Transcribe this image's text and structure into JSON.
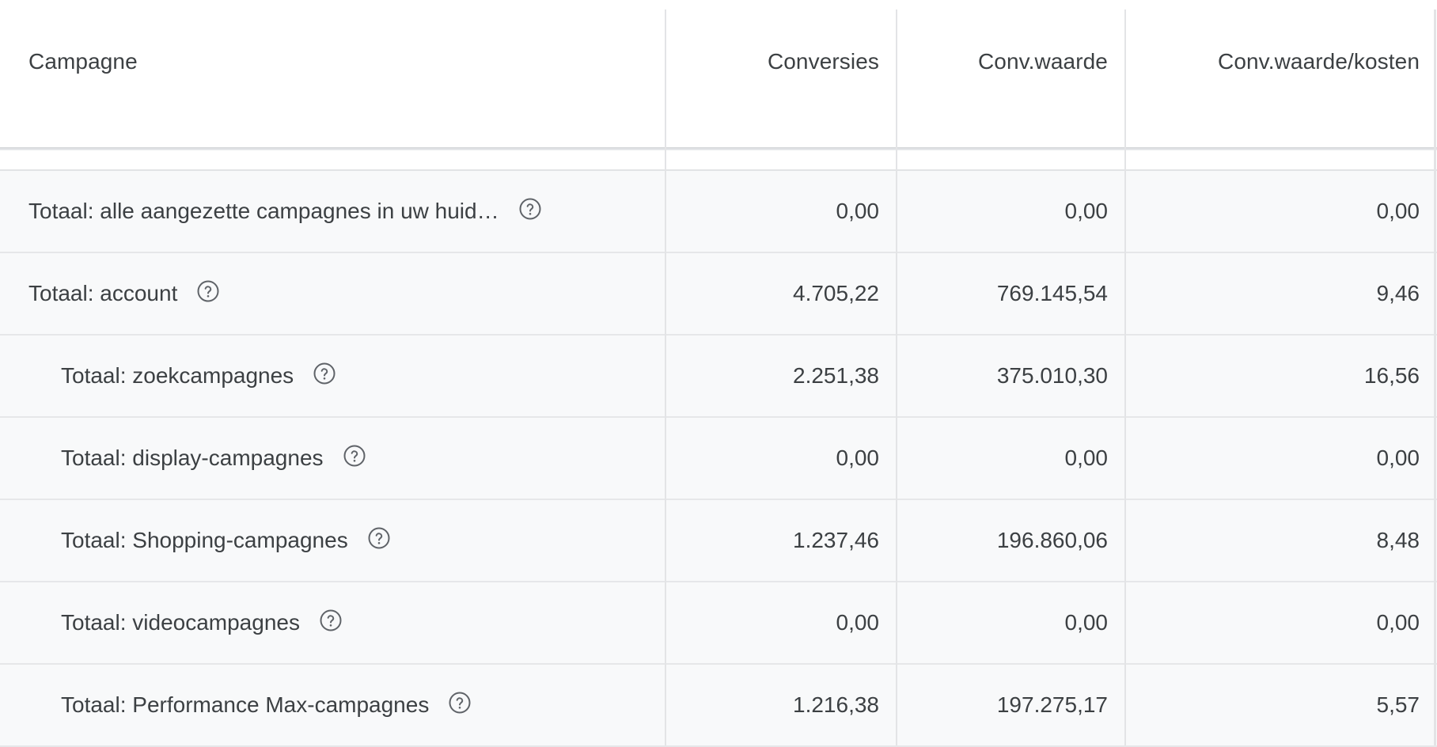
{
  "columns": {
    "campaign": "Campagne",
    "conversions": "Conversies",
    "conv_value": "Conv.waarde",
    "conv_value_cost": "Conv.waarde/kosten"
  },
  "rows": [
    {
      "label": "Totaal: alle aangezette campagnes in uw huid…",
      "conversions": "0,00",
      "conv_value": "0,00",
      "conv_value_cost": "0,00",
      "indent": false
    },
    {
      "label": "Totaal: account",
      "conversions": "4.705,22",
      "conv_value": "769.145,54",
      "conv_value_cost": "9,46",
      "indent": false
    },
    {
      "label": "Totaal: zoekcampagnes",
      "conversions": "2.251,38",
      "conv_value": "375.010,30",
      "conv_value_cost": "16,56",
      "indent": true
    },
    {
      "label": "Totaal: display-campagnes",
      "conversions": "0,00",
      "conv_value": "0,00",
      "conv_value_cost": "0,00",
      "indent": true
    },
    {
      "label": "Totaal: Shopping-campagnes",
      "conversions": "1.237,46",
      "conv_value": "196.860,06",
      "conv_value_cost": "8,48",
      "indent": true
    },
    {
      "label": "Totaal: videocampagnes",
      "conversions": "0,00",
      "conv_value": "0,00",
      "conv_value_cost": "0,00",
      "indent": true
    },
    {
      "label": "Totaal: Performance Max-campagnes",
      "conversions": "1.216,38",
      "conv_value": "197.275,17",
      "conv_value_cost": "5,57",
      "indent": true
    }
  ],
  "icons": {
    "help": "help-circle-icon"
  },
  "colors": {
    "row_background": "#f8f9fa",
    "header_background": "#ffffff",
    "text": "#3c4043",
    "divider": "#e3e4e6"
  }
}
